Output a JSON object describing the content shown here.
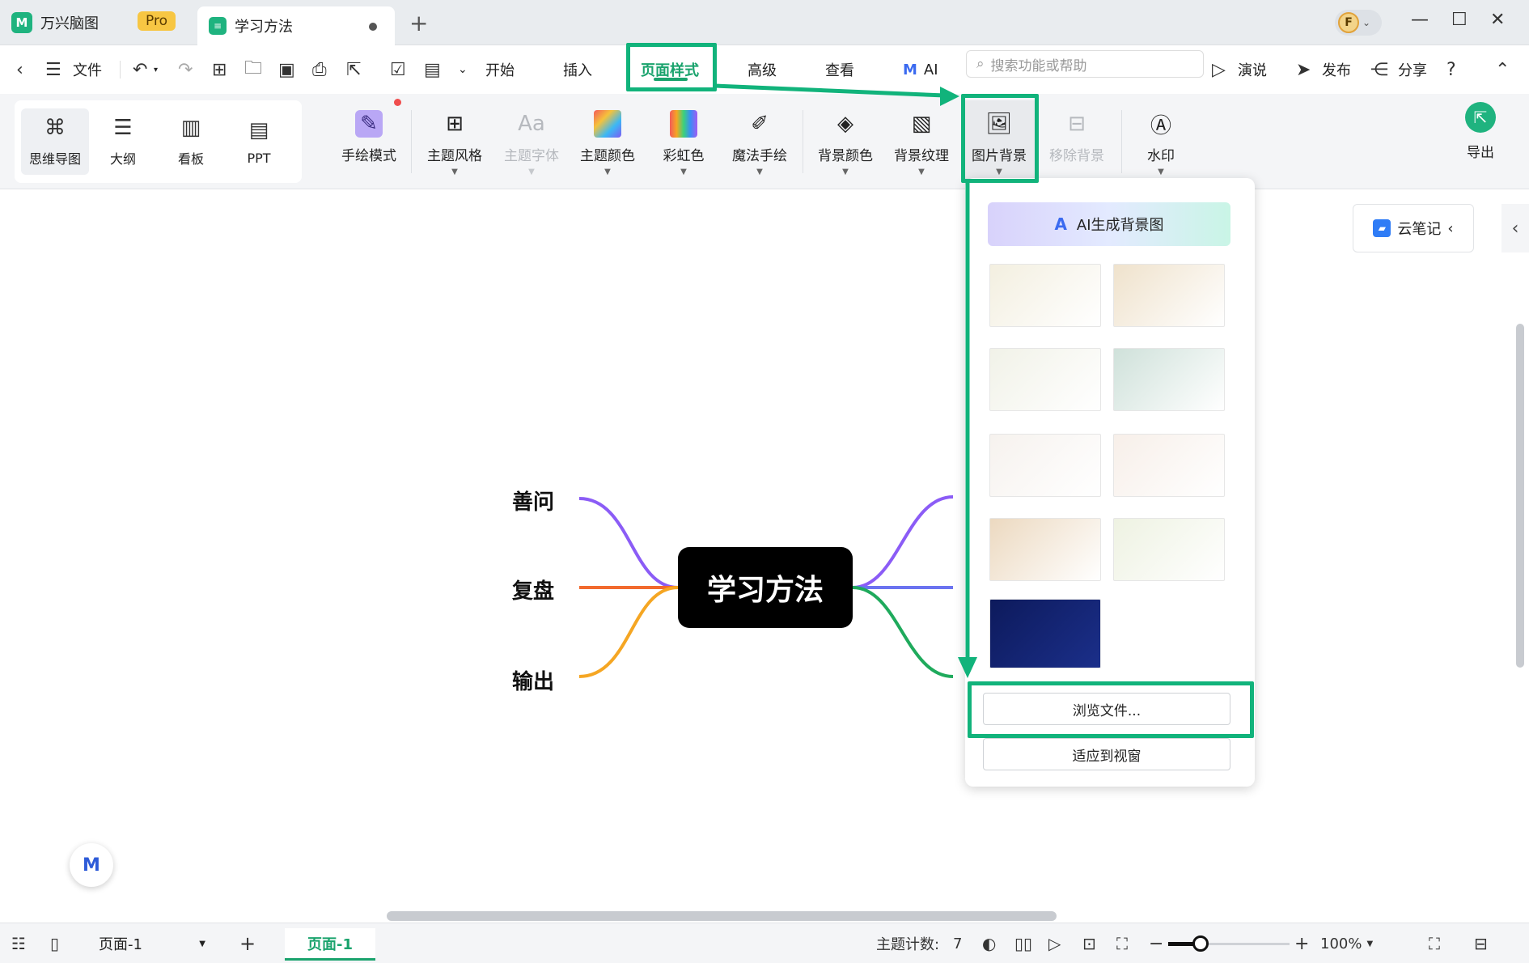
{
  "titlebar": {
    "app_name": "万兴脑图",
    "pro_badge": "Pro",
    "doc_tab_title": "学习方法",
    "avatar_letter": "F"
  },
  "menubar": {
    "file": "文件",
    "tabs": [
      "开始",
      "插入",
      "页面样式",
      "高级",
      "查看",
      "AI"
    ],
    "active_tab": "页面样式",
    "search_placeholder": "搜索功能或帮助",
    "present": "演说",
    "publish": "发布",
    "share": "分享"
  },
  "ribbon": {
    "views": [
      "思维导图",
      "大纲",
      "看板",
      "PPT"
    ],
    "selected_view": "思维导图",
    "tools": [
      {
        "label": "手绘模式",
        "icon": "pen-icon",
        "enabled": true
      },
      {
        "label": "主题风格",
        "icon": "grid-icon",
        "enabled": true
      },
      {
        "label": "主题字体",
        "icon": "font-icon",
        "enabled": false
      },
      {
        "label": "主题颜色",
        "icon": "palette-icon",
        "enabled": true
      },
      {
        "label": "彩虹色",
        "icon": "rainbow-icon",
        "enabled": true
      },
      {
        "label": "魔法手绘",
        "icon": "magic-pen-icon",
        "enabled": true
      },
      {
        "label": "背景颜色",
        "icon": "paint-bucket-icon",
        "enabled": true
      },
      {
        "label": "背景纹理",
        "icon": "texture-icon",
        "enabled": true
      },
      {
        "label": "图片背景",
        "icon": "image-icon",
        "enabled": true
      },
      {
        "label": "移除背景",
        "icon": "remove-image-icon",
        "enabled": false
      },
      {
        "label": "水印",
        "icon": "watermark-icon",
        "enabled": true
      }
    ],
    "export": "导出"
  },
  "dropdown": {
    "ai_button": "AI生成背景图",
    "browse_button": "浏览文件...",
    "fit_button": "适应到视窗",
    "thumbnails": [
      "#f3efe0",
      "#efe2cc",
      "#f1f2e8",
      "#cfe1da",
      "#f6f2ee",
      "#f7efe9",
      "#ecd9c0",
      "#eef2e2",
      "#0d1a5c"
    ]
  },
  "canvas": {
    "central_topic": "学习方法",
    "branches_left": [
      "善问",
      "复盘",
      "输出"
    ],
    "cloud_note": "云笔记"
  },
  "statusbar": {
    "page_select": "页面-1",
    "page_tab": "页面-1",
    "topic_count_label": "主题计数:",
    "topic_count": "7",
    "zoom": "100%"
  },
  "colors": {
    "accent_green": "#1aa36d",
    "annotation_green": "#11b37b",
    "branch_purple": "#8b5cf6",
    "branch_orange_red": "#f26a2e",
    "branch_orange": "#f5a623",
    "branch_blue": "#6b73f0",
    "branch_green": "#1faa5c"
  }
}
